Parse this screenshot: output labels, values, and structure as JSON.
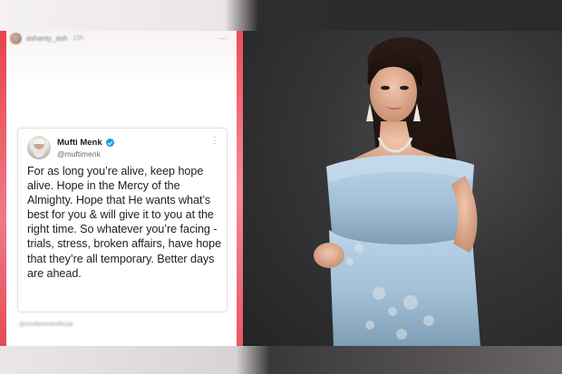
{
  "story": {
    "username": "ashanty_ash",
    "time": "15h",
    "footer_tag": "@muftimenkofficial"
  },
  "tweet": {
    "author_name": "Mufti Menk",
    "handle": "@muftimenk",
    "more_glyph": "⋮",
    "text": "For as long you’re alive, keep hope alive. Hope in the Mercy of the Almighty. Hope that He wants what’s best for you & will give it to you at the right time. So whatever you’re facing - trials, stress, broken affairs, have hope that they’re all temporary. Better days are ahead.",
    "verified_color": "#1d9bf0"
  },
  "photo": {
    "dress_color": "#a9c6dc",
    "background_color": "#353537"
  },
  "colors": {
    "story_frame_accent": "#e8434c"
  }
}
